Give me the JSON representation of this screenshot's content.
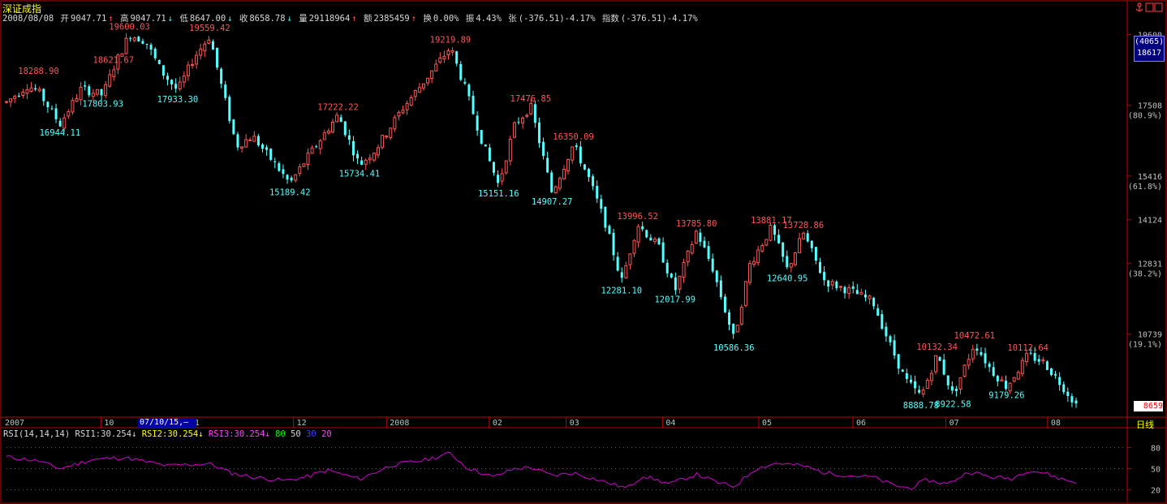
{
  "header": {
    "index_name": "深证成指",
    "date": "2008/08/08",
    "open_label": "开",
    "open_value": "9047.71",
    "open_arrow": "↑",
    "high_label": "高",
    "high_value": "9047.71",
    "high_arrow": "↓",
    "low_label": "低",
    "low_value": "8647.00",
    "low_arrow": "↓",
    "close_label": "收",
    "close_value": "8658.78",
    "close_arrow": "↓",
    "volume_label": "量",
    "volume_value": "29118964",
    "volume_arrow": "↑",
    "amount_label": "额",
    "amount_value": "2385459",
    "amount_arrow": "↑",
    "turnover_label": "换",
    "turnover_value": "0.00%",
    "amplitude_label": "振",
    "amplitude_value": "4.43%",
    "change_label": "张",
    "change_value": "(-376.51)-4.17%",
    "index_change_label": "指数",
    "index_change_value": "(-376.51)-4.17%"
  },
  "right_panel": {
    "box_top": "(4065)",
    "box_bottom": "18617",
    "last_price": "8659",
    "period": "日线"
  },
  "cursor_date": "07/10/15,—",
  "rsi_legend": {
    "params": "RSI(14,14,14)",
    "rsi1": "RSI1:30.254",
    "rsi2": "RSI2:30.254",
    "rsi3": "RSI3:30.254",
    "arrow": "↓",
    "level80": "80",
    "level50": "50",
    "level30": "30",
    "level20": "20"
  },
  "colors": {
    "up": "#ff5555",
    "down": "#55ffff",
    "axis": "#c00000",
    "rsi": "#d000d0",
    "title": "#ffff00"
  },
  "chart_data": [
    {
      "type": "candlestick",
      "ylim": [
        8500,
        19900
      ],
      "price_ticks": [
        {
          "value": 19600,
          "label": "19600",
          "pct": ""
        },
        {
          "value": 17508,
          "label": "17508",
          "pct": "(80.9%)"
        },
        {
          "value": 15416,
          "label": "15416",
          "pct": "(61.8%)"
        },
        {
          "value": 14124,
          "label": "14124",
          "pct": ""
        },
        {
          "value": 12831,
          "label": "12831",
          "pct": "(38.2%)"
        },
        {
          "value": 10739,
          "label": "10739",
          "pct": "(19.1%)"
        }
      ],
      "x_axis_labels": [
        {
          "t": 0.0,
          "label": "2007"
        },
        {
          "t": 0.105,
          "label": "10"
        },
        {
          "t": 0.185,
          "label": "11"
        },
        {
          "t": 0.285,
          "label": "12"
        },
        {
          "t": 0.372,
          "label": "2008"
        },
        {
          "t": 0.468,
          "label": "02"
        },
        {
          "t": 0.54,
          "label": "03"
        },
        {
          "t": 0.63,
          "label": "04"
        },
        {
          "t": 0.72,
          "label": "05"
        },
        {
          "t": 0.808,
          "label": "06"
        },
        {
          "t": 0.895,
          "label": "07"
        },
        {
          "t": 0.99,
          "label": "08"
        }
      ],
      "path": [
        [
          0.0,
          17600
        ],
        [
          0.02,
          18100
        ],
        [
          0.03,
          17900
        ],
        [
          0.05,
          16944
        ],
        [
          0.07,
          18000
        ],
        [
          0.09,
          17803
        ],
        [
          0.1,
          18621
        ],
        [
          0.115,
          19600
        ],
        [
          0.13,
          19400
        ],
        [
          0.145,
          18500
        ],
        [
          0.16,
          17933
        ],
        [
          0.175,
          18900
        ],
        [
          0.19,
          19559
        ],
        [
          0.2,
          18200
        ],
        [
          0.215,
          16300
        ],
        [
          0.23,
          16600
        ],
        [
          0.25,
          15800
        ],
        [
          0.265,
          15189
        ],
        [
          0.28,
          15900
        ],
        [
          0.31,
          17222
        ],
        [
          0.33,
          15734
        ],
        [
          0.345,
          16200
        ],
        [
          0.37,
          17400
        ],
        [
          0.39,
          18200
        ],
        [
          0.415,
          19219
        ],
        [
          0.43,
          17900
        ],
        [
          0.445,
          16400
        ],
        [
          0.46,
          15151
        ],
        [
          0.475,
          16900
        ],
        [
          0.49,
          17476
        ],
        [
          0.51,
          14907
        ],
        [
          0.53,
          16350
        ],
        [
          0.545,
          15300
        ],
        [
          0.56,
          14000
        ],
        [
          0.575,
          12281
        ],
        [
          0.59,
          13996
        ],
        [
          0.61,
          13300
        ],
        [
          0.625,
          12017
        ],
        [
          0.645,
          13785
        ],
        [
          0.66,
          12700
        ],
        [
          0.68,
          10586
        ],
        [
          0.695,
          12800
        ],
        [
          0.715,
          13881
        ],
        [
          0.73,
          12640
        ],
        [
          0.745,
          13728
        ],
        [
          0.765,
          12300
        ],
        [
          0.79,
          12000
        ],
        [
          0.81,
          11700
        ],
        [
          0.825,
          10500
        ],
        [
          0.84,
          9400
        ],
        [
          0.855,
          8888
        ],
        [
          0.87,
          10132
        ],
        [
          0.885,
          8922
        ],
        [
          0.905,
          10472
        ],
        [
          0.92,
          9700
        ],
        [
          0.935,
          9179
        ],
        [
          0.955,
          10112
        ],
        [
          0.97,
          9900
        ],
        [
          0.985,
          9300
        ],
        [
          1.0,
          8658
        ]
      ],
      "annotations": [
        {
          "t": 0.03,
          "value": 18288.9,
          "label": "18288.90",
          "kind": "high"
        },
        {
          "t": 0.05,
          "value": 16944.11,
          "label": "16944.11",
          "kind": "low"
        },
        {
          "t": 0.1,
          "value": 18621.67,
          "label": "18621.67",
          "kind": "high"
        },
        {
          "t": 0.09,
          "value": 17803.93,
          "label": "17803.93",
          "kind": "low"
        },
        {
          "t": 0.115,
          "value": 19600.03,
          "label": "19600.03",
          "kind": "high"
        },
        {
          "t": 0.16,
          "value": 17933.3,
          "label": "17933.30",
          "kind": "low"
        },
        {
          "t": 0.19,
          "value": 19559.42,
          "label": "19559.42",
          "kind": "high"
        },
        {
          "t": 0.265,
          "value": 15189.42,
          "label": "15189.42",
          "kind": "low"
        },
        {
          "t": 0.31,
          "value": 17222.22,
          "label": "17222.22",
          "kind": "high"
        },
        {
          "t": 0.33,
          "value": 15734.41,
          "label": "15734.41",
          "kind": "low"
        },
        {
          "t": 0.415,
          "value": 19219.89,
          "label": "19219.89",
          "kind": "high"
        },
        {
          "t": 0.46,
          "value": 15151.16,
          "label": "15151.16",
          "kind": "low"
        },
        {
          "t": 0.49,
          "value": 17476.85,
          "label": "17476.85",
          "kind": "high"
        },
        {
          "t": 0.51,
          "value": 14907.27,
          "label": "14907.27",
          "kind": "low"
        },
        {
          "t": 0.53,
          "value": 16350.09,
          "label": "16350.09",
          "kind": "high"
        },
        {
          "t": 0.575,
          "value": 12281.1,
          "label": "12281.10",
          "kind": "low"
        },
        {
          "t": 0.59,
          "value": 13996.52,
          "label": "13996.52",
          "kind": "high"
        },
        {
          "t": 0.625,
          "value": 12017.99,
          "label": "12017.99",
          "kind": "low"
        },
        {
          "t": 0.645,
          "value": 13785.8,
          "label": "13785.80",
          "kind": "high"
        },
        {
          "t": 0.68,
          "value": 10586.36,
          "label": "10586.36",
          "kind": "low"
        },
        {
          "t": 0.715,
          "value": 13881.17,
          "label": "13881.17",
          "kind": "high"
        },
        {
          "t": 0.745,
          "value": 13728.86,
          "label": "13728.86",
          "kind": "high"
        },
        {
          "t": 0.73,
          "value": 12640.95,
          "label": "12640.95",
          "kind": "low"
        },
        {
          "t": 0.855,
          "value": 8888.78,
          "label": "8888.78",
          "kind": "low"
        },
        {
          "t": 0.87,
          "value": 10132.34,
          "label": "10132.34",
          "kind": "high"
        },
        {
          "t": 0.885,
          "value": 8922.58,
          "label": "8922.58",
          "kind": "low"
        },
        {
          "t": 0.905,
          "value": 10472.61,
          "label": "10472.61",
          "kind": "high"
        },
        {
          "t": 0.935,
          "value": 9179.26,
          "label": "9179.26",
          "kind": "low"
        },
        {
          "t": 0.955,
          "value": 10112.64,
          "label": "10112.64",
          "kind": "high"
        }
      ]
    },
    {
      "type": "line",
      "name": "RSI",
      "ylim": [
        10,
        90
      ],
      "levels": [
        80,
        50,
        20
      ],
      "path": [
        [
          0.0,
          67
        ],
        [
          0.03,
          61
        ],
        [
          0.05,
          50
        ],
        [
          0.08,
          63
        ],
        [
          0.11,
          66
        ],
        [
          0.13,
          60
        ],
        [
          0.15,
          54
        ],
        [
          0.17,
          56
        ],
        [
          0.19,
          57
        ],
        [
          0.21,
          44
        ],
        [
          0.23,
          38
        ],
        [
          0.26,
          33
        ],
        [
          0.28,
          38
        ],
        [
          0.3,
          48
        ],
        [
          0.33,
          35
        ],
        [
          0.36,
          55
        ],
        [
          0.39,
          62
        ],
        [
          0.415,
          72
        ],
        [
          0.43,
          52
        ],
        [
          0.455,
          38
        ],
        [
          0.475,
          50
        ],
        [
          0.49,
          52
        ],
        [
          0.51,
          40
        ],
        [
          0.53,
          44
        ],
        [
          0.56,
          31
        ],
        [
          0.58,
          22
        ],
        [
          0.595,
          40
        ],
        [
          0.62,
          28
        ],
        [
          0.645,
          42
        ],
        [
          0.665,
          30
        ],
        [
          0.68,
          24
        ],
        [
          0.7,
          50
        ],
        [
          0.72,
          58
        ],
        [
          0.745,
          54
        ],
        [
          0.765,
          44
        ],
        [
          0.79,
          40
        ],
        [
          0.81,
          38
        ],
        [
          0.83,
          26
        ],
        [
          0.845,
          22
        ],
        [
          0.86,
          34
        ],
        [
          0.88,
          28
        ],
        [
          0.9,
          46
        ],
        [
          0.92,
          38
        ],
        [
          0.94,
          36
        ],
        [
          0.955,
          48
        ],
        [
          0.97,
          44
        ],
        [
          0.985,
          36
        ],
        [
          1.0,
          30
        ]
      ]
    }
  ]
}
